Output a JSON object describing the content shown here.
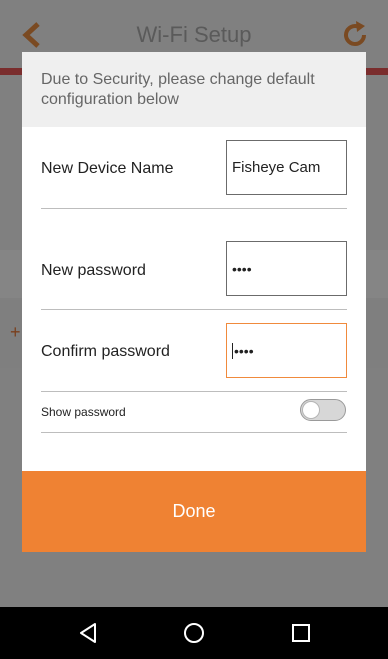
{
  "app": {
    "title": "Wi-Fi Setup",
    "background_glyph": "+"
  },
  "dialog": {
    "message": "Due to Security, please change default configuration below",
    "fields": {
      "device_name": {
        "label": "New Device Name",
        "value": "Fisheye Cam"
      },
      "new_password": {
        "label": "New password",
        "value": "••••"
      },
      "confirm_password": {
        "label": "Confirm password",
        "value": "••••"
      }
    },
    "show_password": {
      "label": "Show password",
      "enabled": false
    },
    "done_label": "Done"
  },
  "colors": {
    "accent": "#ef8233",
    "focus_border": "#f08a3c"
  },
  "icons": {
    "back": "chevron-left-icon",
    "refresh": "refresh-icon",
    "nav_back": "triangle-back-icon",
    "nav_home": "circle-home-icon",
    "nav_recent": "square-recent-icon"
  }
}
